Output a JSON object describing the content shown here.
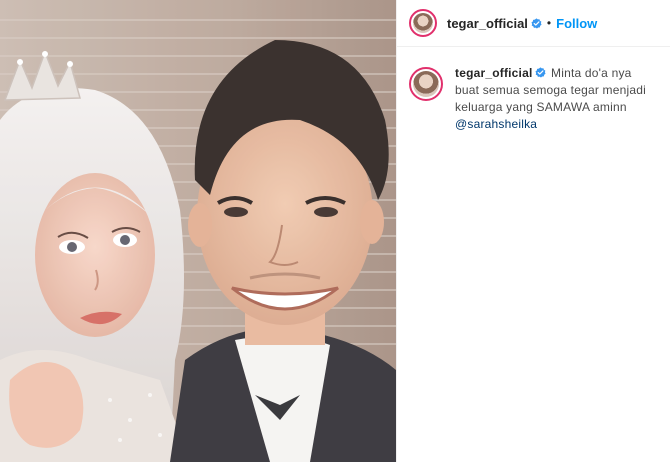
{
  "header": {
    "username": "tegar_official",
    "separator": "•",
    "follow_label": "Follow"
  },
  "comment": {
    "username": "tegar_official",
    "caption": "Minta do'a nya buat semua semoga tegar menjadi keluarga yang SAMAWA aminn",
    "mention": "@sarahsheilka"
  },
  "colors": {
    "accent": "#0095f6",
    "verified": "#3897f0",
    "story_ring": "#e1306c"
  },
  "icons": {
    "verified": "verified-badge-icon"
  }
}
